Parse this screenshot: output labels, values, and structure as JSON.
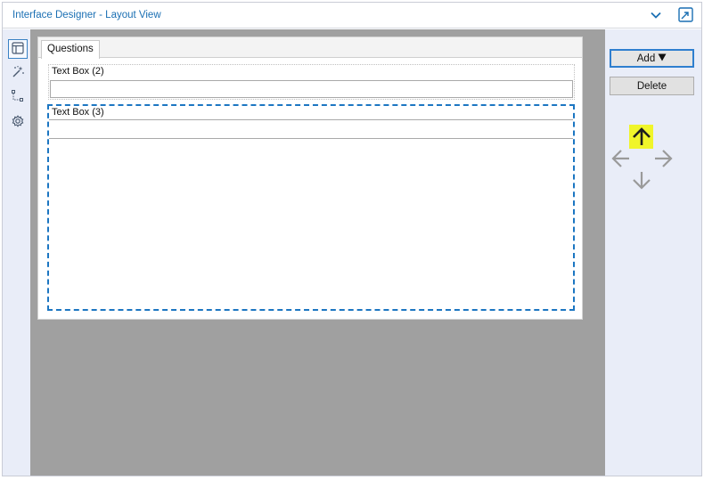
{
  "window": {
    "title": "Interface Designer - Layout View"
  },
  "toolbar": {
    "collapse_icon": "chevron-down-icon",
    "popout_icon": "popout-window-icon"
  },
  "left_sidebar": {
    "items": [
      {
        "name": "layout-view",
        "icon": "layout-icon",
        "active": true
      },
      {
        "name": "actions",
        "icon": "magic-wand-icon",
        "active": false
      },
      {
        "name": "tree-view",
        "icon": "tree-icon",
        "active": false
      },
      {
        "name": "properties",
        "icon": "gear-icon",
        "active": false
      }
    ]
  },
  "layout_panel": {
    "tabs": [
      {
        "label": "Questions",
        "selected": true
      }
    ],
    "controls": [
      {
        "label": "Text Box (2)",
        "value": "",
        "selected": false
      },
      {
        "label": "Text Box (3)",
        "value": "",
        "selected": true
      }
    ]
  },
  "right_panel": {
    "add_label": "Add",
    "add_icon": "triangle-down-icon",
    "delete_label": "Delete",
    "move_arrows": {
      "up": {
        "icon": "arrow-up-icon",
        "highlighted": true
      },
      "left": {
        "icon": "arrow-left-icon",
        "highlighted": false
      },
      "right": {
        "icon": "arrow-right-icon",
        "highlighted": false
      },
      "down": {
        "icon": "arrow-down-icon",
        "highlighted": false
      }
    }
  },
  "colors": {
    "accent": "#1c76c2",
    "title_text": "#1a6fb3",
    "sidebar_bg": "#e9edf8",
    "canvas_bg": "#a0a0a0",
    "highlight": "#f0f52a",
    "arrow_gray": "#9a9a9a"
  }
}
